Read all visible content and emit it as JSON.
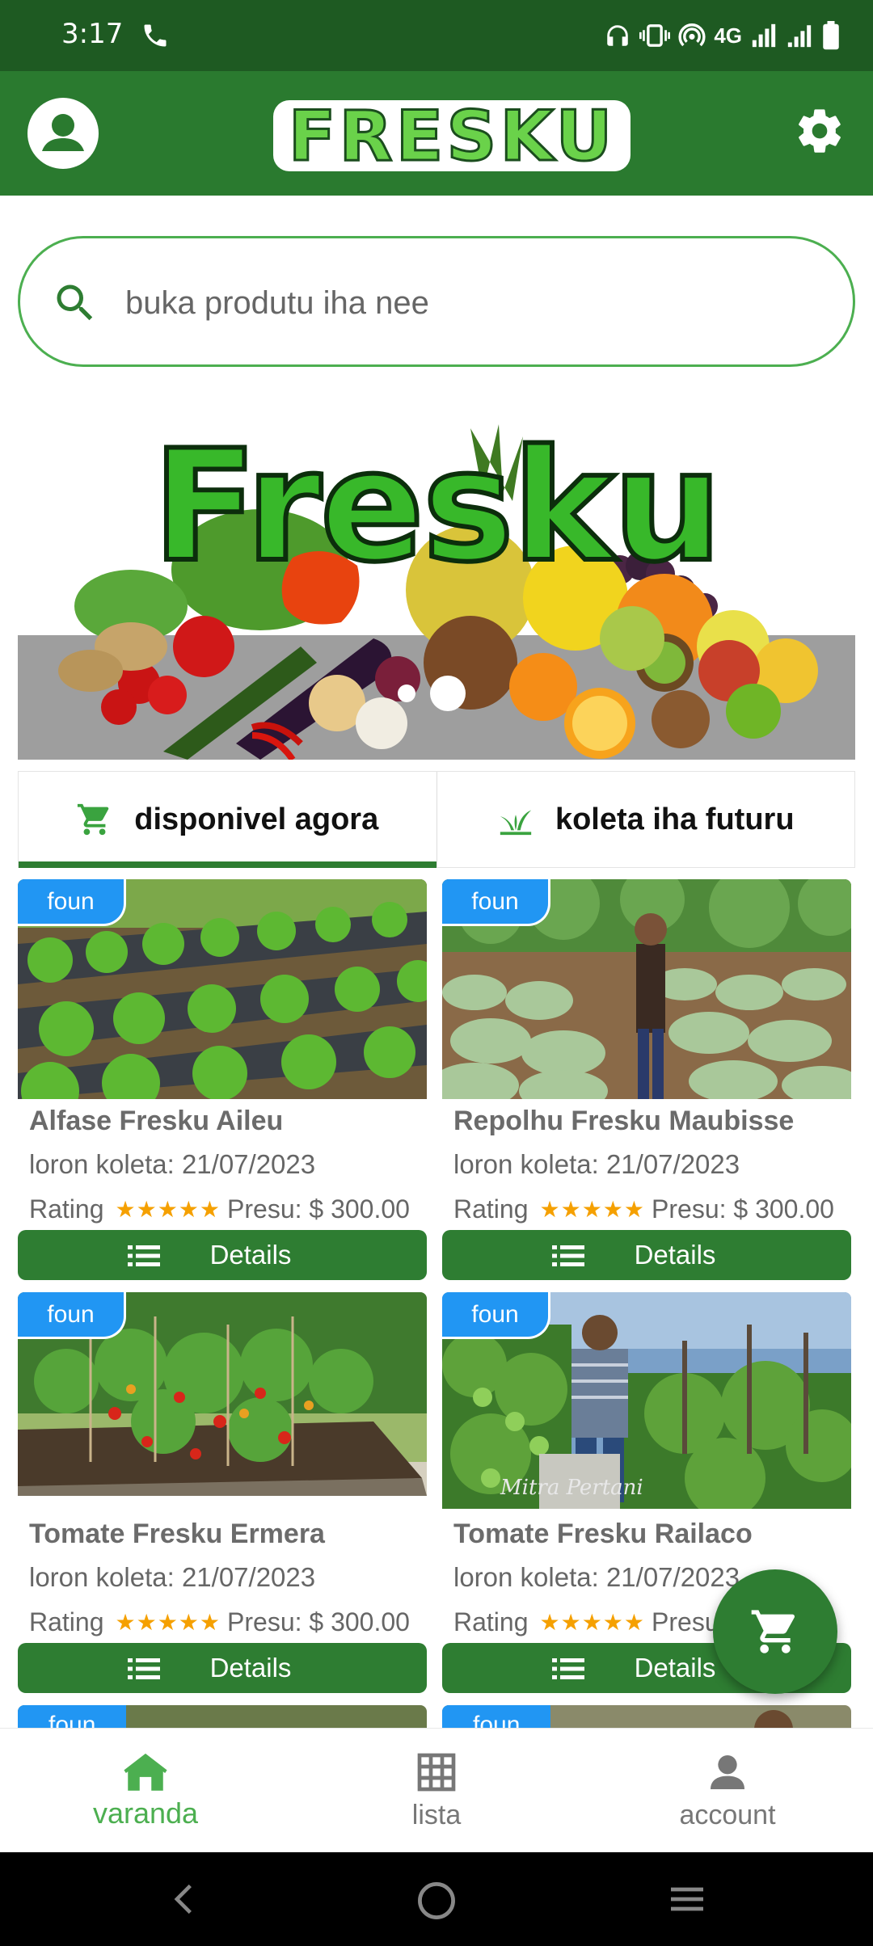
{
  "status_bar": {
    "time": "3:17",
    "network": "4G",
    "icons": [
      "phone-icon",
      "headphones-icon",
      "vibrate-icon",
      "hotspot-icon",
      "signal-icon",
      "battery-icon"
    ]
  },
  "app_bar": {
    "logo_text": "FRESKU",
    "icons": [
      "account-circle-icon",
      "settings-icon"
    ]
  },
  "search": {
    "placeholder": "buka produtu iha nee",
    "value": ""
  },
  "banner": {
    "title": "Fresku",
    "slide_count": 2,
    "active_slide": 2
  },
  "tabs": [
    {
      "label": "disponivel agora",
      "icon": "cart-icon",
      "active": true
    },
    {
      "label": "koleta iha futuru",
      "icon": "sprout-icon",
      "active": false
    }
  ],
  "products": [
    {
      "badge": "foun",
      "name": "Alfase Fresku Aileu",
      "date": "loron koleta: 21/07/2023",
      "rating_label": "Rating",
      "stars": 5,
      "price": "Presu: $ 300.00",
      "button": "Details"
    },
    {
      "badge": "foun",
      "name": "Repolhu Fresku Maubisse",
      "date": "loron koleta: 21/07/2023",
      "rating_label": "Rating",
      "stars": 5,
      "price": "Presu: $ 300.00",
      "button": "Details"
    },
    {
      "badge": "foun",
      "name": "Tomate Fresku Ermera",
      "date": "loron koleta: 21/07/2023",
      "rating_label": "Rating",
      "stars": 5,
      "price": "Presu: $ 300.00",
      "button": "Details"
    },
    {
      "badge": "foun",
      "name": "Tomate Fresku Railaco",
      "date": "loron koleta: 21/07/2023",
      "rating_label": "Rating",
      "stars": 5,
      "price": "Presu: $ 300.00",
      "button": "Details"
    }
  ],
  "peek_badges": [
    "foun",
    "foun"
  ],
  "photo_watermark": "Mitra Pertani",
  "fab": {
    "icon": "cart-icon"
  },
  "bottom_nav": [
    {
      "label": "varanda",
      "icon": "home-icon",
      "active": true
    },
    {
      "label": "lista",
      "icon": "grid-icon",
      "active": false
    },
    {
      "label": "account",
      "icon": "person-icon",
      "active": false
    }
  ],
  "colors": {
    "primary": "#2a7a2f",
    "status_bar": "#1e5a22",
    "accent": "#4caf50",
    "badge": "#2196f3",
    "star": "#f5a000"
  }
}
